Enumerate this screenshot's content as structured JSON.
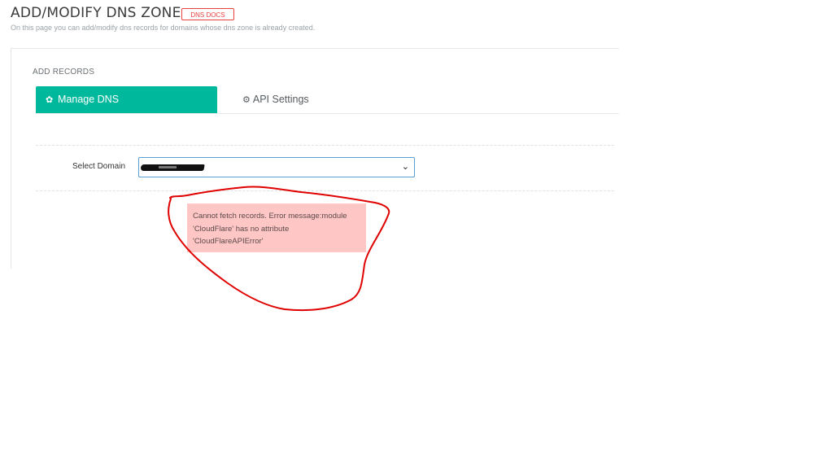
{
  "header": {
    "title": "ADD/MODIFY DNS ZONE -",
    "docs_badge": "DNS DOCS",
    "subtitle": "On this page you can add/modify dns records for domains whose dns zone is already created."
  },
  "section": {
    "caption": "ADD RECORDS"
  },
  "tabs": [
    {
      "label": "Manage DNS",
      "icon": "gear-icon",
      "active": true
    },
    {
      "label": "API Settings",
      "icon": "gears-icon",
      "active": false
    }
  ],
  "form": {
    "domain_label": "Select Domain",
    "domain_value_redacted": true
  },
  "error": {
    "line1": "Cannot fetch records. Error message:module",
    "line2": "'CloudFlare' has no attribute",
    "line3": "'CloudFlareAPIError'"
  },
  "colors": {
    "accent": "#00b89c",
    "badge": "#e8423f",
    "error_bg": "#ffc6c6",
    "annotation": "#e00000"
  }
}
